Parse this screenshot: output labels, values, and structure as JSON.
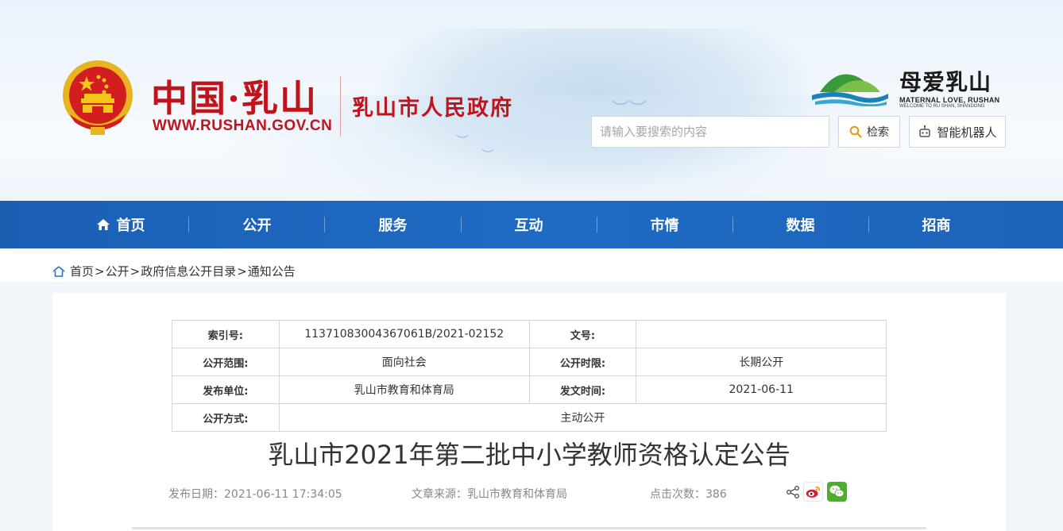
{
  "header": {
    "site_name_cn": "中国·乳山",
    "site_url": "WWW.RUSHAN.GOV.CN",
    "gov_name": "乳山市人民政府",
    "brand_cn": "母爱乳山",
    "brand_en": "MATERNAL LOVE, RUSHAN",
    "brand_en_sub": "WELCOME TO RU SHAN, SHANDONG",
    "search_placeholder": "请输入要搜索的内容",
    "search_button": "检索",
    "robot_button": "智能机器人"
  },
  "nav": {
    "items": [
      "首页",
      "公开",
      "服务",
      "互动",
      "市情",
      "数据",
      "招商"
    ]
  },
  "breadcrumb": {
    "items": [
      "首页",
      "公开",
      "政府信息公开目录",
      "通知公告"
    ],
    "separator": ">"
  },
  "meta": {
    "index_no_label": "索引号:",
    "index_no": "11371083004367061B/2021-02152",
    "doc_no_label": "文号:",
    "doc_no": "",
    "scope_label": "公开范围:",
    "scope": "面向社会",
    "period_label": "公开时限:",
    "period": "长期公开",
    "publisher_label": "发布单位:",
    "publisher": "乳山市教育和体育局",
    "issue_time_label": "发文时间:",
    "issue_time": "2021-06-11",
    "method_label": "公开方式:",
    "method": "主动公开"
  },
  "article": {
    "title": "乳山市2021年第二批中小学教师资格认定公告",
    "publish_date": "发布日期：2021-06-11 17:34:05",
    "source": "文章来源：乳山市教育和体育局",
    "clicks": "点击次数：386"
  },
  "colors": {
    "brand_red": "#c0141c",
    "nav_blue": "#1f6bc4",
    "wechat_green": "#4caf2c",
    "weibo_red": "#e6162d"
  }
}
